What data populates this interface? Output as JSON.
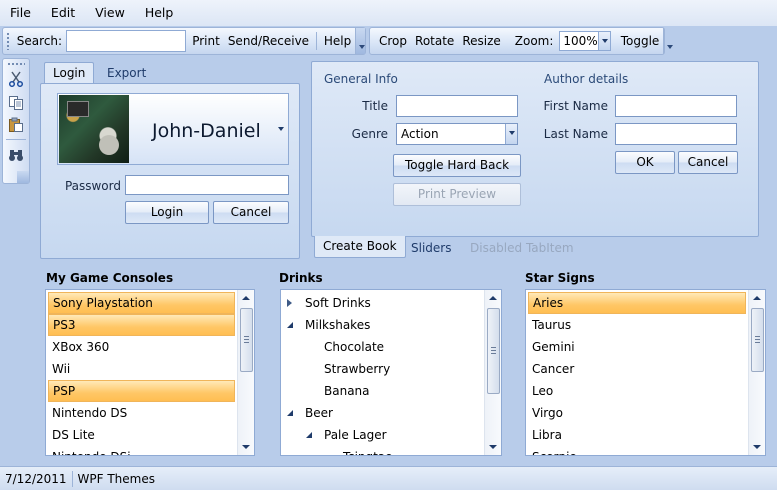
{
  "menu": [
    "File",
    "Edit",
    "View",
    "Help"
  ],
  "toolbar1": {
    "search_label": "Search:",
    "search_value": "",
    "print": "Print",
    "send_receive": "Send/Receive",
    "help": "Help"
  },
  "toolbar2": {
    "crop": "Crop",
    "rotate": "Rotate",
    "resize": "Resize",
    "zoom_label": "Zoom:",
    "zoom_value": "100%",
    "toggle": "Toggle"
  },
  "vertical_toolbar": [
    "scissors-icon",
    "copy-icon",
    "paste-icon",
    "binoculars-icon"
  ],
  "login_panel": {
    "tabs": [
      "Login",
      "Export"
    ],
    "active_tab": "Login",
    "user_name": "John-Daniel",
    "password_label": "Password",
    "password_value": "",
    "login_button": "Login",
    "cancel_button": "Cancel"
  },
  "book_panel": {
    "general_info_label": "General Info",
    "title_label": "Title",
    "title_value": "",
    "genre_label": "Genre",
    "genre_value": "Action",
    "toggle_hard_back": "Toggle Hard Back",
    "print_preview": "Print Preview",
    "author_details_label": "Author details",
    "first_name_label": "First Name",
    "first_name_value": "",
    "last_name_label": "Last Name",
    "last_name_value": "",
    "ok_button": "OK",
    "cancel_button": "Cancel",
    "tabs": [
      "Create Book",
      "Sliders",
      "Disabled TabItem"
    ],
    "active_tab": "Create Book"
  },
  "game_consoles": {
    "title": "My Game Consoles",
    "items": [
      {
        "label": "Sony Playstation",
        "selected": true
      },
      {
        "label": "PS3",
        "selected": true
      },
      {
        "label": "XBox 360",
        "selected": false
      },
      {
        "label": "Wii",
        "selected": false
      },
      {
        "label": "PSP",
        "selected": true
      },
      {
        "label": "Nintendo DS",
        "selected": false
      },
      {
        "label": "DS Lite",
        "selected": false
      },
      {
        "label": "Nintendo DSi",
        "selected": false
      }
    ]
  },
  "drinks": {
    "title": "Drinks",
    "items": [
      {
        "label": "Soft Drinks",
        "level": 0,
        "expander": "collapsed"
      },
      {
        "label": "Milkshakes",
        "level": 0,
        "expander": "expanded"
      },
      {
        "label": "Chocolate",
        "level": 1,
        "expander": "none"
      },
      {
        "label": "Strawberry",
        "level": 1,
        "expander": "none"
      },
      {
        "label": "Banana",
        "level": 1,
        "expander": "none"
      },
      {
        "label": "Beer",
        "level": 0,
        "expander": "expanded"
      },
      {
        "label": "Pale Lager",
        "level": 1,
        "expander": "expanded"
      },
      {
        "label": "Tsingtao",
        "level": 2,
        "expander": "none"
      }
    ]
  },
  "star_signs": {
    "title": "Star Signs",
    "items": [
      {
        "label": "Aries",
        "selected": true
      },
      {
        "label": "Taurus",
        "selected": false
      },
      {
        "label": "Gemini",
        "selected": false
      },
      {
        "label": "Cancer",
        "selected": false
      },
      {
        "label": "Leo",
        "selected": false
      },
      {
        "label": "Virgo",
        "selected": false
      },
      {
        "label": "Libra",
        "selected": false
      },
      {
        "label": "Scorpio",
        "selected": false
      }
    ]
  },
  "status": {
    "date": "7/12/2011",
    "text": "WPF Themes"
  }
}
